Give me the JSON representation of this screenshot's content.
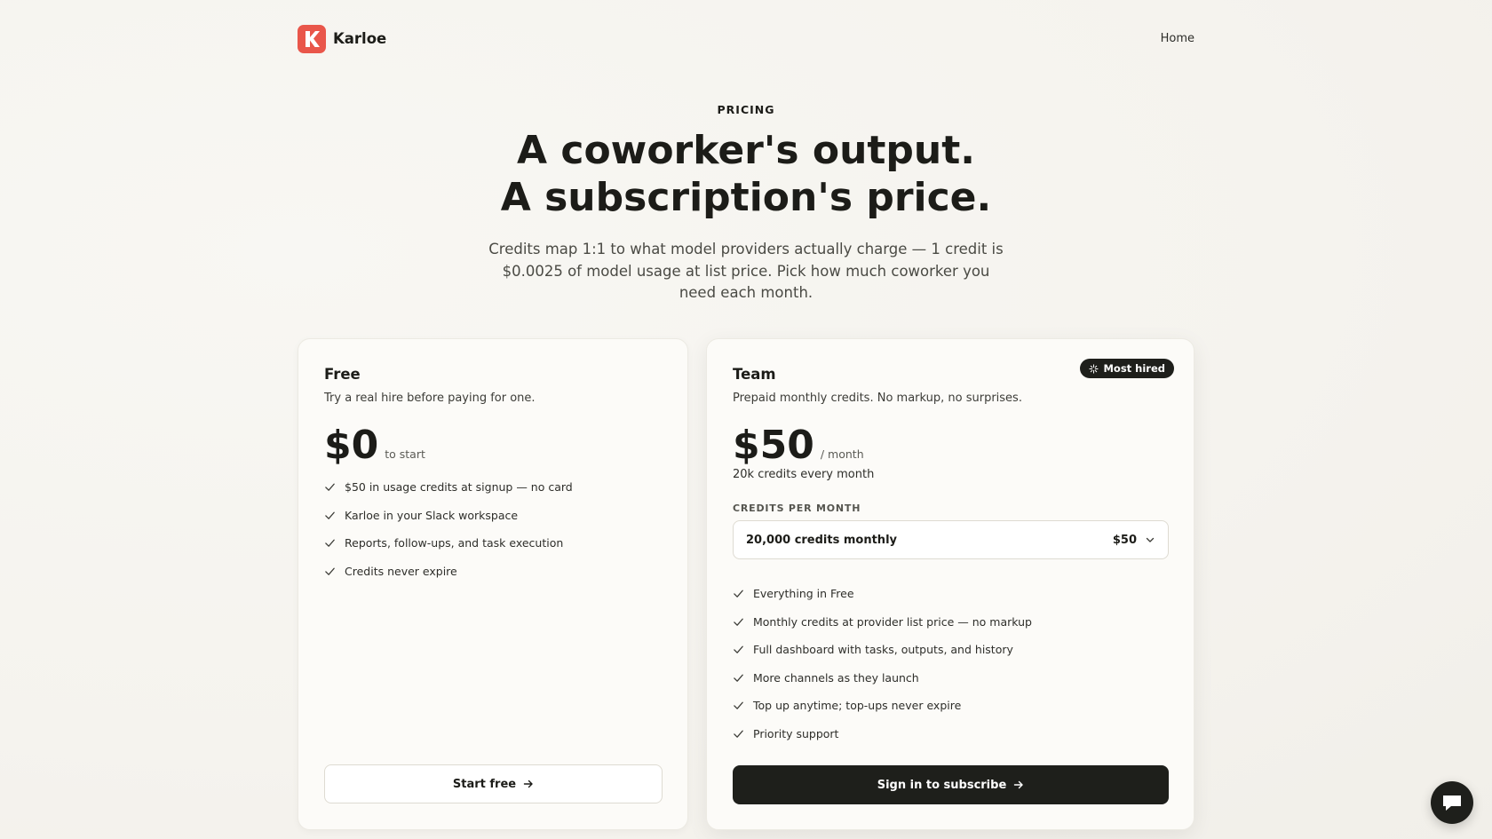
{
  "nav": {
    "brand_name": "Karloe",
    "home_link": "Home"
  },
  "hero": {
    "eyebrow": "PRICING",
    "title_line1": "A coworker's output.",
    "title_line2": "A subscription's price.",
    "subtitle": "Credits map 1:1 to what model providers actually charge — 1 credit is $0.0025 of model usage at list price. Pick how much coworker you need each month."
  },
  "plans": {
    "free": {
      "name": "Free",
      "description": "Try a real hire before paying for one.",
      "price": "$0",
      "price_suffix": "to start",
      "features": [
        "$50 in usage credits at signup — no card",
        "Karloe in your Slack workspace",
        "Reports, follow-ups, and task execution",
        "Credits never expire"
      ],
      "cta": "Start free"
    },
    "team": {
      "name": "Team",
      "badge": "Most hired",
      "description": "Prepaid monthly credits. No markup, no surprises.",
      "price": "$50",
      "price_suffix": "/ month",
      "credits_line": "20k credits every month",
      "select_label": "CREDITS PER MONTH",
      "select_value": "20,000 credits monthly",
      "select_price": "$50",
      "features": [
        "Everything in Free",
        "Monthly credits at provider list price — no markup",
        "Full dashboard with tasks, outputs, and history",
        "More channels as they launch",
        "Top up anytime; top-ups never expire",
        "Priority support"
      ],
      "cta": "Sign in to subscribe"
    }
  },
  "colors": {
    "brand": "#e9564a",
    "dark": "#1e1f1b",
    "background": "#f6f4ef"
  },
  "icons": {
    "logo": "k-logo-icon",
    "check": "check-icon",
    "arrow": "arrow-right-icon",
    "chevron": "chevron-down-icon",
    "sparkle": "sparkle-icon",
    "chat": "chat-bubble-icon"
  }
}
